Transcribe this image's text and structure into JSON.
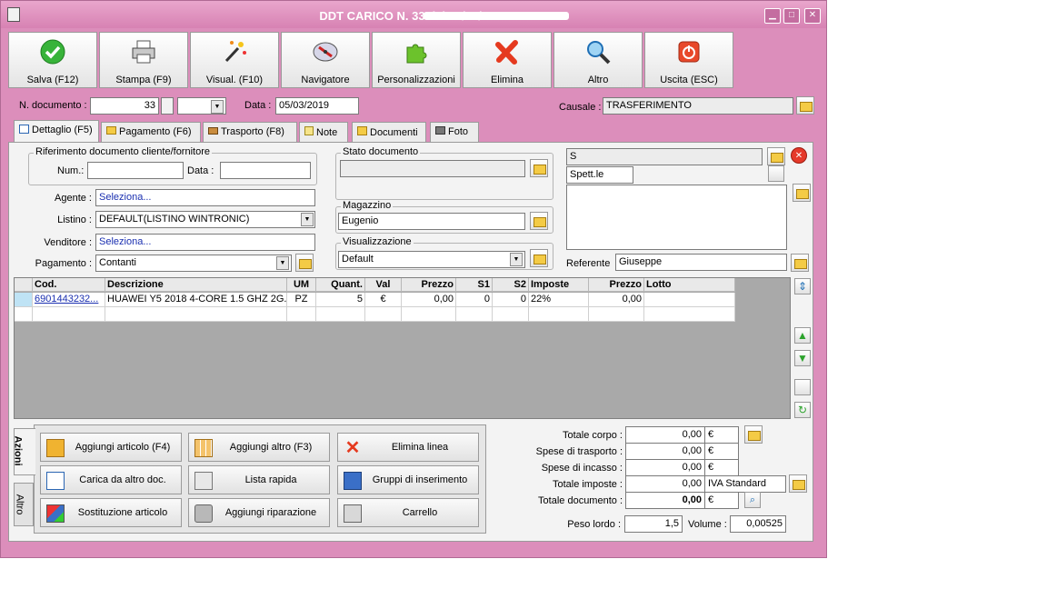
{
  "window": {
    "title": "DDT CARICO N. 33 del 05/03/2019"
  },
  "toolbar": [
    {
      "label": "Salva (F12)",
      "icon": "check-icon"
    },
    {
      "label": "Stampa (F9)",
      "icon": "printer-icon"
    },
    {
      "label": "Visual. (F10)",
      "icon": "magic-wand-icon"
    },
    {
      "label": "Navigatore",
      "icon": "compass-icon"
    },
    {
      "label": "Personalizzazioni",
      "icon": "puzzle-icon"
    },
    {
      "label": "Elimina",
      "icon": "delete-x-icon"
    },
    {
      "label": "Altro",
      "icon": "magnifier-icon"
    },
    {
      "label": "Uscita (ESC)",
      "icon": "power-icon"
    }
  ],
  "header": {
    "num_label": "N. documento :",
    "num_value": "33",
    "data_label": "Data :",
    "data_value": "05/03/2019",
    "causale_label": "Causale :",
    "causale_value": "TRASFERIMENTO"
  },
  "tabs": [
    "Dettaglio (F5)",
    "Pagamento (F6)",
    "Trasporto (F8)",
    "Note",
    "Documenti",
    "Foto"
  ],
  "rif": {
    "title": "Riferimento documento cliente/fornitore",
    "num_label": "Num.:",
    "data_label": "Data :"
  },
  "fields": {
    "agente_label": "Agente :",
    "agente_value": "Seleziona...",
    "listino_label": "Listino :",
    "listino_value": "DEFAULT(LISTINO WINTRONIC)",
    "venditore_label": "Venditore :",
    "venditore_value": "Seleziona...",
    "pagamento_label": "Pagamento :",
    "pagamento_value": "Contanti"
  },
  "stato": {
    "title": "Stato documento"
  },
  "magazzino": {
    "title": "Magazzino",
    "value": "Eugenio"
  },
  "visualizzazione": {
    "title": "Visualizzazione",
    "value": "Default"
  },
  "cliente": {
    "prefix": "S",
    "greeting": "Spett.le",
    "referente_label": "Referente",
    "referente_value": "Giuseppe"
  },
  "grid": {
    "headers": [
      "Cod.",
      "Descrizione",
      "UM",
      "Quant.",
      "Val",
      "Prezzo",
      "S1",
      "S2",
      "Imposte",
      "Prezzo",
      "Lotto"
    ],
    "row": [
      "6901443232...",
      "HUAWEI Y5 2018 4-CORE 1.5 GHZ 2G...",
      "PZ",
      "5",
      "€",
      "0,00",
      "0",
      "0",
      "22%",
      "0,00",
      ""
    ]
  },
  "side_tabs": [
    "Azioni",
    "Altro"
  ],
  "actions": [
    "Aggiungi articolo (F4)",
    "Aggiungi altro (F3)",
    "Elimina linea",
    "Carica da altro doc.",
    "Lista rapida",
    "Gruppi di inserimento",
    "Sostituzione articolo",
    "Aggiungi riparazione",
    "Carrello"
  ],
  "totals": {
    "corpo_label": "Totale corpo :",
    "corpo_value": "0,00",
    "trasporto_label": "Spese di trasporto :",
    "trasporto_value": "0,00",
    "incasso_label": "Spese di incasso :",
    "incasso_value": "0,00",
    "imposte_label": "Totale imposte :",
    "imposte_value": "0,00",
    "iva_value": "IVA Standard",
    "documento_label": "Totale documento :",
    "documento_value": "0,00",
    "currency": "€",
    "peso_label": "Peso lordo :",
    "peso_value": "1,5",
    "volume_label": "Volume :",
    "volume_value": "0,00525"
  },
  "colors": {
    "frame": "#dc8ebb",
    "panel": "#f3f3f3",
    "grid_bg": "#a9a9a9",
    "link": "#1a2fb0"
  }
}
